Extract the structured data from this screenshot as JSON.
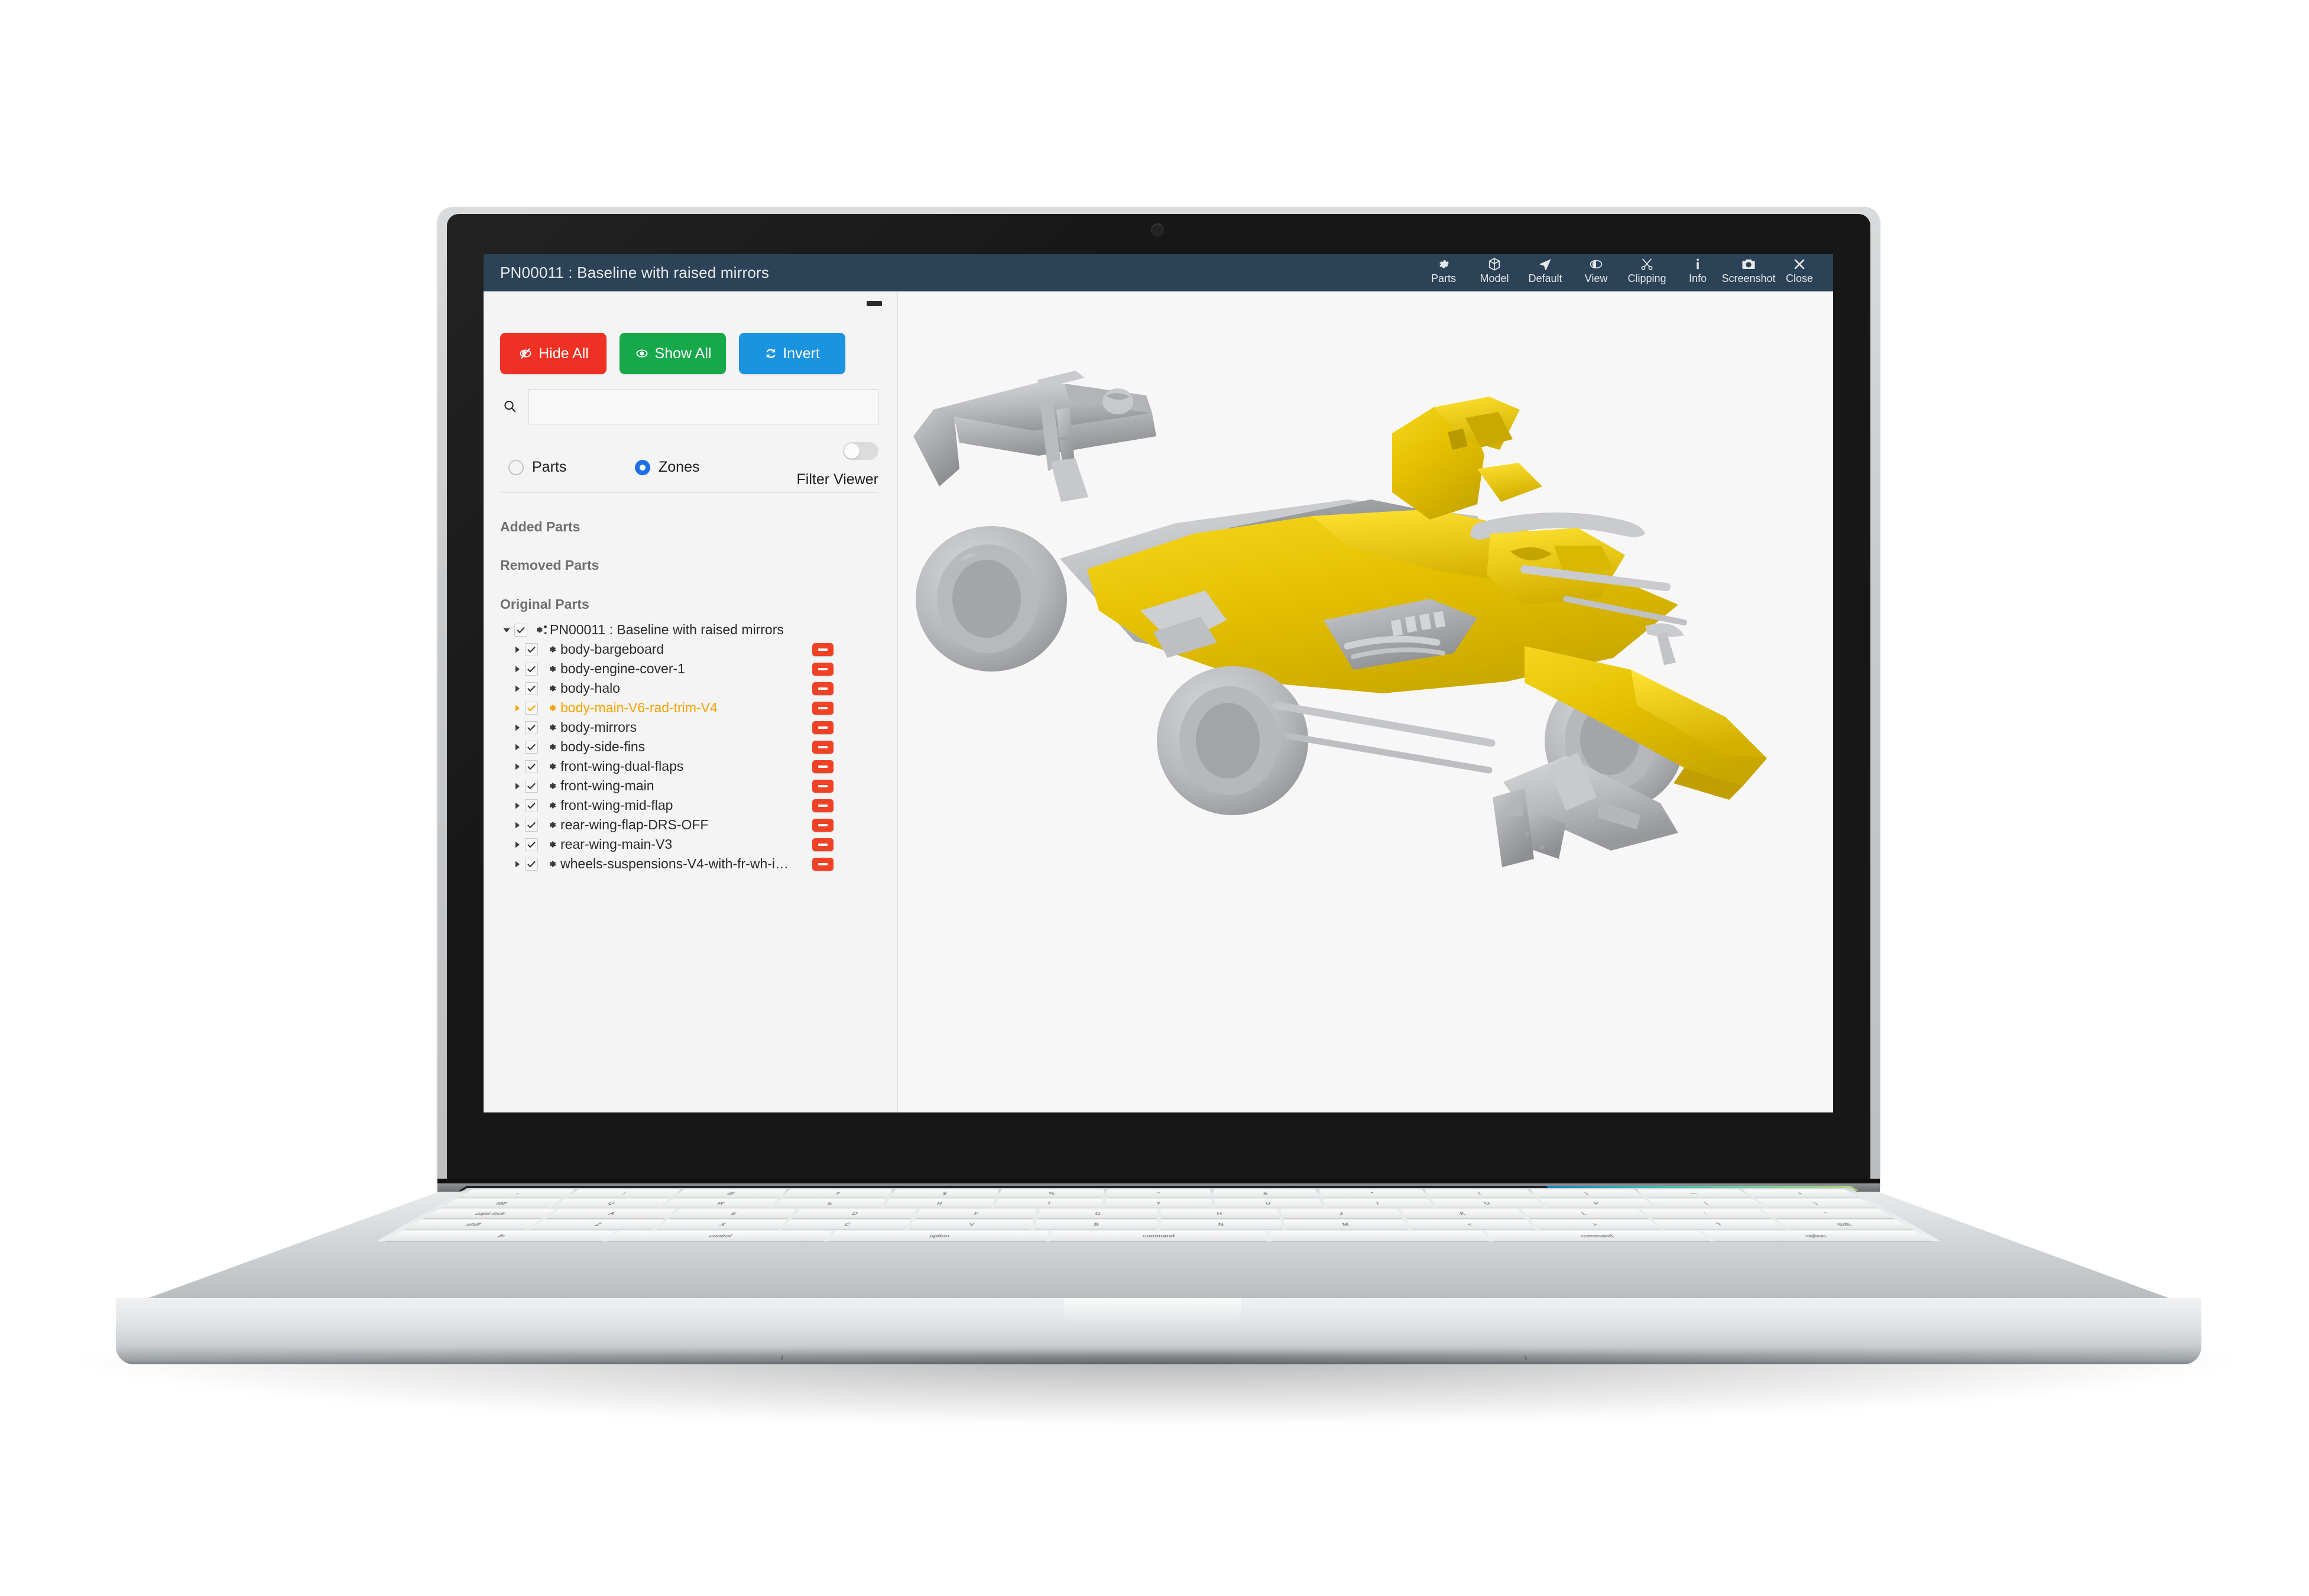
{
  "app": {
    "title": "PN00011 : Baseline with raised mirrors",
    "toolbar": [
      {
        "label": "Parts",
        "icon": "gear-icon"
      },
      {
        "label": "Model",
        "icon": "cube-icon"
      },
      {
        "label": "Default",
        "icon": "cursor-arrow-icon"
      },
      {
        "label": "View",
        "icon": "eye-icon"
      },
      {
        "label": "Clipping",
        "icon": "scissors-icon"
      },
      {
        "label": "Info",
        "icon": "info-icon"
      },
      {
        "label": "Screenshot",
        "icon": "camera-icon"
      },
      {
        "label": "Close",
        "icon": "close-icon"
      }
    ]
  },
  "panel": {
    "buttons": {
      "hide_all": "Hide All",
      "show_all": "Show All",
      "invert": "Invert"
    },
    "colors": {
      "hide_all": "#ee3124",
      "show_all": "#17a84a",
      "invert": "#1a93e0",
      "selected_item": "#f5a302",
      "badge": "#f04124",
      "radio_on": "#1f6fe5",
      "titlebar": "#2b4257"
    },
    "search": {
      "value": "",
      "placeholder": ""
    },
    "filters": {
      "parts_label": "Parts",
      "zones_label": "Zones",
      "selected": "Zones",
      "filter_viewer_label": "Filter Viewer",
      "filter_viewer_on": false
    },
    "sections": {
      "added": "Added Parts",
      "removed": "Removed Parts",
      "original": "Original Parts"
    },
    "tree": {
      "root": {
        "label": "PN00011 : Baseline with raised mirrors",
        "expanded": true,
        "checked": true,
        "icon": "gears-icon",
        "has_badge": true
      },
      "children": [
        {
          "label": "body-bargeboard",
          "checked": true,
          "selected": false,
          "icon": "gear-icon",
          "has_badge": true
        },
        {
          "label": "body-engine-cover-1",
          "checked": true,
          "selected": false,
          "icon": "gear-icon",
          "has_badge": true
        },
        {
          "label": "body-halo",
          "checked": true,
          "selected": false,
          "icon": "gear-icon",
          "has_badge": true
        },
        {
          "label": "body-main-V6-rad-trim-V4",
          "checked": true,
          "selected": true,
          "icon": "gear-icon",
          "has_badge": true
        },
        {
          "label": "body-mirrors",
          "checked": true,
          "selected": false,
          "icon": "gear-icon",
          "has_badge": true
        },
        {
          "label": "body-side-fins",
          "checked": true,
          "selected": false,
          "icon": "gear-icon",
          "has_badge": true
        },
        {
          "label": "front-wing-dual-flaps",
          "checked": true,
          "selected": false,
          "icon": "gear-icon",
          "has_badge": true
        },
        {
          "label": "front-wing-main",
          "checked": true,
          "selected": false,
          "icon": "gear-icon",
          "has_badge": true
        },
        {
          "label": "front-wing-mid-flap",
          "checked": true,
          "selected": false,
          "icon": "gear-icon",
          "has_badge": true
        },
        {
          "label": "rear-wing-flap-DRS-OFF",
          "checked": true,
          "selected": false,
          "icon": "gear-icon",
          "has_badge": true
        },
        {
          "label": "rear-wing-main-V3",
          "checked": true,
          "selected": false,
          "icon": "gear-icon",
          "has_badge": true
        },
        {
          "label": "wheels-suspensions-V4-with-fr-wh-i…",
          "checked": true,
          "selected": false,
          "icon": "gear-icon",
          "has_badge": true
        }
      ]
    }
  },
  "viewer": {
    "model_name": "Formula 1 car",
    "highlight_color": "#e8c000",
    "body_color": "#b9babc",
    "background": "#f7f7f7"
  },
  "keyboard": {
    "row1": [
      "~",
      "!",
      "@",
      "#",
      "$",
      "%",
      "^",
      "&",
      "*",
      "(",
      ")",
      "—",
      "+"
    ],
    "row2": [
      "tab",
      "Q",
      "W",
      "E",
      "R",
      "T",
      "Y",
      "U",
      "I",
      "O",
      "P",
      "{",
      "}"
    ],
    "row3": [
      "caps lock",
      "A",
      "S",
      "D",
      "F",
      "G",
      "H",
      "J",
      "K",
      "L",
      ":",
      "\""
    ],
    "row4": [
      "shift",
      "Z",
      "X",
      "C",
      "V",
      "B",
      "N",
      "M",
      "<",
      ">",
      "?",
      "shift"
    ],
    "row5": [
      "fn",
      "control",
      "option",
      "command",
      "",
      "command",
      "option"
    ]
  }
}
